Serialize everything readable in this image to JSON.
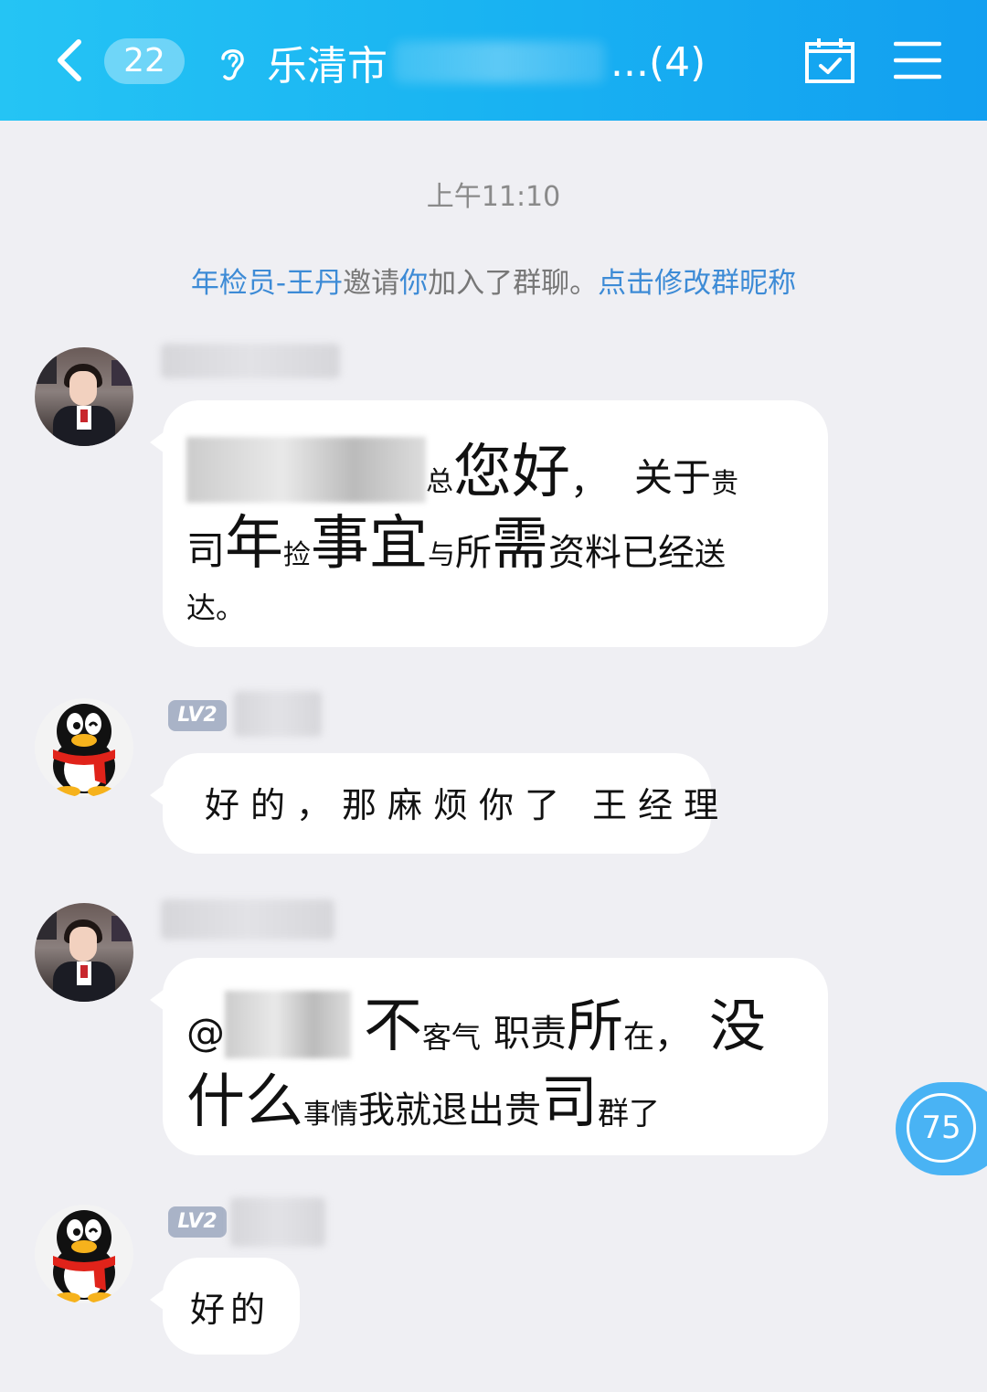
{
  "header": {
    "unread_count": "22",
    "title_prefix": "乐清市",
    "title_suffix": "...(4)",
    "bg_color": "#19b3f2"
  },
  "chat": {
    "timestamp": "上午11:10",
    "system_message": {
      "inviter": "年检员-王丹",
      "middle_1": "邀请",
      "you": "你",
      "middle_2": "加入了群聊。",
      "link": "点击修改群昵称"
    },
    "messages": [
      {
        "sender": "agent",
        "line1": [
          "总",
          "您好",
          "，",
          "关于",
          "贵"
        ],
        "line2": [
          "司",
          "年",
          "捡",
          "事宜",
          "与",
          "所",
          "需",
          "资料已经",
          "送"
        ],
        "line3": "达。"
      },
      {
        "sender": "member",
        "level": "LV2",
        "text": "好的，那麻烦你了 王经理"
      },
      {
        "sender": "agent",
        "line1": [
          "@",
          "不",
          "客气",
          "职责",
          "所",
          "在",
          "，",
          "没"
        ],
        "line2": [
          "什么",
          "事情",
          "我就退出贵",
          "司",
          "群了"
        ]
      },
      {
        "sender": "member",
        "level": "LV2",
        "text": "好的"
      }
    ]
  },
  "floating_badge": "75",
  "icons": [
    "back-chevron-icon",
    "ear-icon",
    "calendar-check-icon",
    "menu-icon",
    "penguin-avatar-icon"
  ]
}
